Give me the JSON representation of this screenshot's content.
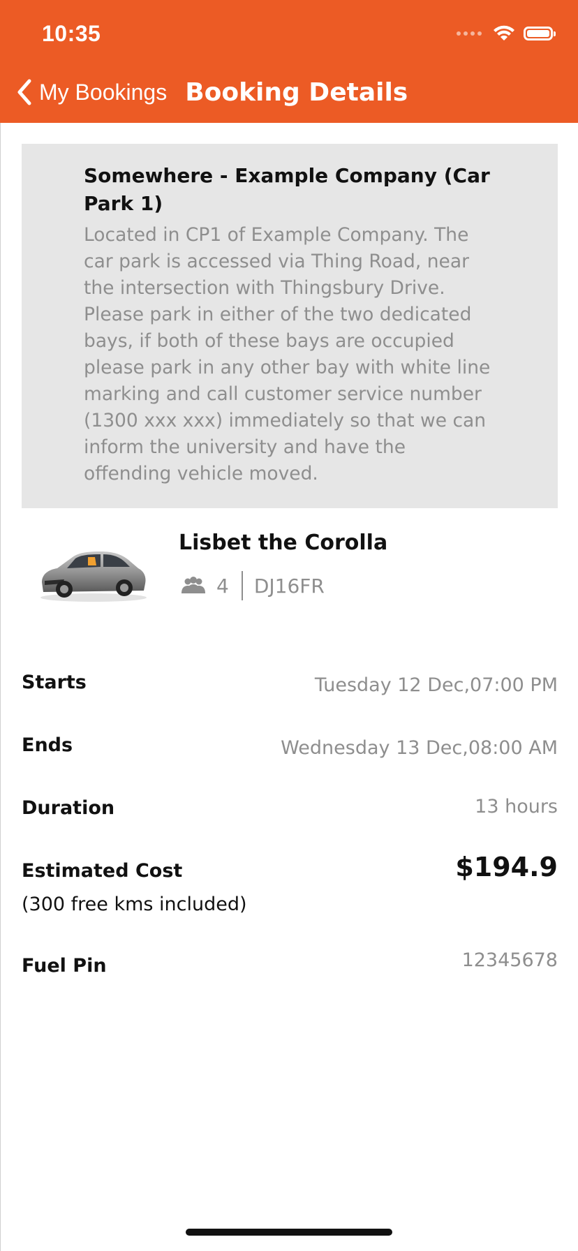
{
  "status_bar": {
    "time": "10:35",
    "icons": [
      "signal-dots-icon",
      "wifi-icon",
      "battery-icon"
    ]
  },
  "nav": {
    "back_label": "My Bookings",
    "title": "Booking Details",
    "back_icon": "chevron-left-icon"
  },
  "location": {
    "title": "Somewhere - Example Company (Car Park 1)",
    "description": "Located in CP1 of Example Company. The car park is accessed via Thing Road, near the intersection with Thingsbury Drive. Please park in either of the two dedicated bays, if both of these bays are occupied please park in any other bay with white line marking and call customer service number (1300 xxx xxx) immediately so that we can inform the university and have the offending vehicle moved."
  },
  "vehicle": {
    "name": "Lisbet the Corolla",
    "seats": "4",
    "plate": "DJ16FR",
    "image_icon": "car-image",
    "seats_icon": "people-icon"
  },
  "details": {
    "starts_label": "Starts",
    "starts_value": "Tuesday 12 Dec,07:00 PM",
    "ends_label": "Ends",
    "ends_value": "Wednesday 13 Dec,08:00 AM",
    "duration_label": "Duration",
    "duration_value": "13 hours",
    "cost_label": "Estimated Cost",
    "cost_note": "(300 free kms included)",
    "cost_value": "$194.9",
    "fuel_label": "Fuel Pin",
    "fuel_value": "12345678"
  },
  "colors": {
    "header": "#EC5B25",
    "card": "#E6E6E6",
    "muted_text": "#8E8E8E"
  }
}
